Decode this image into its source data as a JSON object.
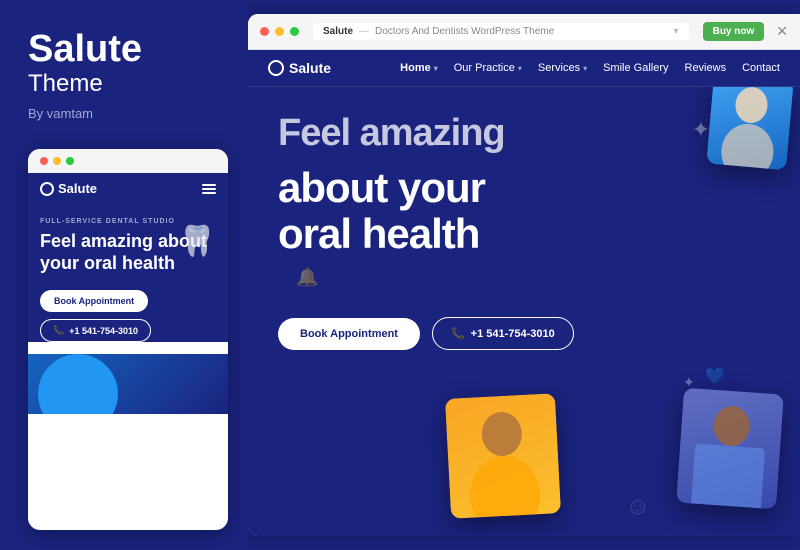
{
  "leftPanel": {
    "brandTitle": "Salute",
    "brandSubtitle": "Theme",
    "brandBy": "By vamtam",
    "mobileCard": {
      "serviceLabel": "FULL-SERVICE DENTAL STUDIO",
      "heroText": "Feel amazing about your oral health",
      "bookBtn": "Book Appointment",
      "phoneBtn": "+1 541-754-3010"
    }
  },
  "rightPanel": {
    "browserBar": {
      "urlBrand": "Salute",
      "urlSep": "—",
      "urlDesc": "Doctors And Dentists WordPress Theme",
      "buyNow": "Buy now",
      "close": "✕"
    },
    "navbar": {
      "logo": "Salute",
      "links": [
        {
          "label": "Home",
          "hasDropdown": true,
          "active": true
        },
        {
          "label": "Our Practice",
          "hasDropdown": true
        },
        {
          "label": "Services",
          "hasDropdown": true
        },
        {
          "label": "Smile Gallery"
        },
        {
          "label": "Reviews"
        },
        {
          "label": "Contact"
        }
      ]
    },
    "hero": {
      "headlineTop": "Feel amazing",
      "headlineLine2": "about your",
      "headlineLine3": "oral health",
      "bookBtn": "Book Appointment",
      "phoneBtn": "+1 541-754-3010"
    }
  }
}
